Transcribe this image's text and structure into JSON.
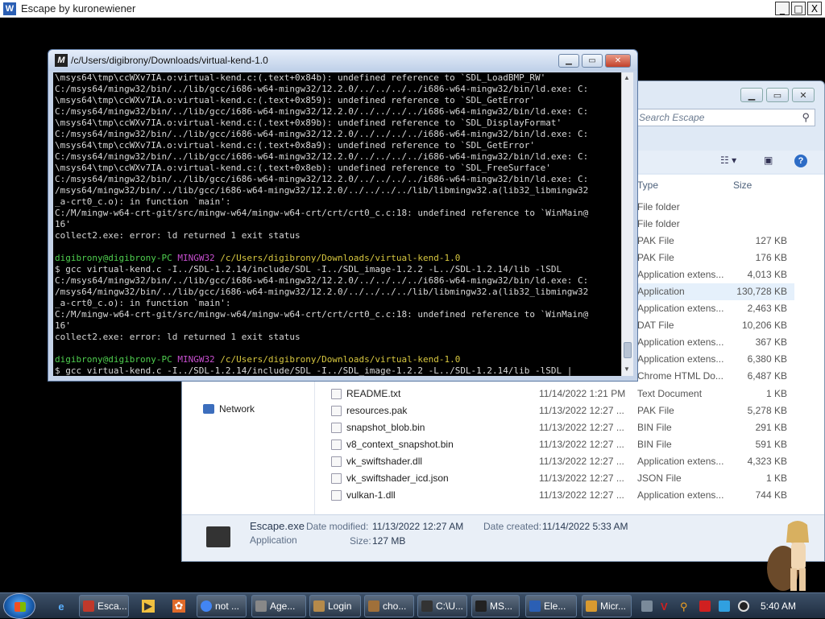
{
  "outer_window": {
    "title": "Escape by kuronewiener",
    "minimize": "_",
    "maximize": "□",
    "close": "X"
  },
  "explorer": {
    "search_placeholder": "Search Escape",
    "columns": {
      "type": "Type",
      "size": "Size"
    },
    "partial_rows": [
      {
        "type": "File folder",
        "size": ""
      },
      {
        "type": "File folder",
        "size": ""
      },
      {
        "type": "PAK File",
        "size": "127 KB"
      },
      {
        "type": "PAK File",
        "size": "176 KB"
      },
      {
        "type": "Application extens...",
        "size": "4,013 KB"
      },
      {
        "type": "Application",
        "size": "130,728 KB"
      },
      {
        "type": "Application extens...",
        "size": "2,463 KB"
      },
      {
        "type": "DAT File",
        "size": "10,206 KB"
      },
      {
        "type": "Application extens...",
        "size": "367 KB"
      },
      {
        "type": "Application extens...",
        "size": "6,380 KB"
      },
      {
        "type": "Chrome HTML Do...",
        "size": "6,487 KB"
      }
    ],
    "rows": [
      {
        "name": "README.txt",
        "date": "11/14/2022 1:21 PM",
        "type": "Text Document",
        "size": "1 KB"
      },
      {
        "name": "resources.pak",
        "date": "11/13/2022 12:27 ...",
        "type": "PAK File",
        "size": "5,278 KB"
      },
      {
        "name": "snapshot_blob.bin",
        "date": "11/13/2022 12:27 ...",
        "type": "BIN File",
        "size": "291 KB"
      },
      {
        "name": "v8_context_snapshot.bin",
        "date": "11/13/2022 12:27 ...",
        "type": "BIN File",
        "size": "591 KB"
      },
      {
        "name": "vk_swiftshader.dll",
        "date": "11/13/2022 12:27 ...",
        "type": "Application extens...",
        "size": "4,323 KB"
      },
      {
        "name": "vk_swiftshader_icd.json",
        "date": "11/13/2022 12:27 ...",
        "type": "JSON File",
        "size": "1 KB"
      },
      {
        "name": "vulkan-1.dll",
        "date": "11/13/2022 12:27 ...",
        "type": "Application extens...",
        "size": "744 KB"
      }
    ],
    "nav_network": "Network",
    "details": {
      "filename": "Escape.exe",
      "filetype": "Application",
      "modified_label": "Date modified:",
      "modified_value": "11/13/2022 12:27 AM",
      "created_label": "Date created:",
      "created_value": "11/14/2022 5:33 AM",
      "size_label": "Size:",
      "size_value": "127 MB"
    }
  },
  "terminal": {
    "title": "/c/Users/digibrony/Downloads/virtual-kend-1.0",
    "lines": [
      {
        "t": "\\msys64\\tmp\\ccWXv7IA.o:virtual-kend.c:(.text+0x84b): undefined reference to `SDL_LoadBMP_RW'",
        "c": ""
      },
      {
        "t": "C:/msys64/mingw32/bin/../lib/gcc/i686-w64-mingw32/12.2.0/../../../../i686-w64-mingw32/bin/ld.exe: C:",
        "c": ""
      },
      {
        "t": "\\msys64\\tmp\\ccWXv7IA.o:virtual-kend.c:(.text+0x859): undefined reference to `SDL_GetError'",
        "c": ""
      },
      {
        "t": "C:/msys64/mingw32/bin/../lib/gcc/i686-w64-mingw32/12.2.0/../../../../i686-w64-mingw32/bin/ld.exe: C:",
        "c": ""
      },
      {
        "t": "\\msys64\\tmp\\ccWXv7IA.o:virtual-kend.c:(.text+0x89b): undefined reference to `SDL_DisplayFormat'",
        "c": ""
      },
      {
        "t": "C:/msys64/mingw32/bin/../lib/gcc/i686-w64-mingw32/12.2.0/../../../../i686-w64-mingw32/bin/ld.exe: C:",
        "c": ""
      },
      {
        "t": "\\msys64\\tmp\\ccWXv7IA.o:virtual-kend.c:(.text+0x8a9): undefined reference to `SDL_GetError'",
        "c": ""
      },
      {
        "t": "C:/msys64/mingw32/bin/../lib/gcc/i686-w64-mingw32/12.2.0/../../../../i686-w64-mingw32/bin/ld.exe: C:",
        "c": ""
      },
      {
        "t": "\\msys64\\tmp\\ccWXv7IA.o:virtual-kend.c:(.text+0x8eb): undefined reference to `SDL_FreeSurface'",
        "c": ""
      },
      {
        "t": "C:/msys64/mingw32/bin/../lib/gcc/i686-w64-mingw32/12.2.0/../../../../i686-w64-mingw32/bin/ld.exe: C:",
        "c": ""
      },
      {
        "t": "/msys64/mingw32/bin/../lib/gcc/i686-w64-mingw32/12.2.0/../../../../lib/libmingw32.a(lib32_libmingw32",
        "c": ""
      },
      {
        "t": "_a-crt0_c.o): in function `main':",
        "c": ""
      },
      {
        "t": "C:/M/mingw-w64-crt-git/src/mingw-w64/mingw-w64-crt/crt/crt0_c.c:18: undefined reference to `WinMain@",
        "c": ""
      },
      {
        "t": "16'",
        "c": ""
      },
      {
        "t": "collect2.exe: error: ld returned 1 exit status",
        "c": ""
      },
      {
        "t": "",
        "c": ""
      },
      {
        "t": "PROMPT",
        "c": "prompt"
      },
      {
        "t": "$ gcc virtual-kend.c -I../SDL-1.2.14/include/SDL -I../SDL_image-1.2.2 -L../SDL-1.2.14/lib -lSDL",
        "c": ""
      },
      {
        "t": "C:/msys64/mingw32/bin/../lib/gcc/i686-w64-mingw32/12.2.0/../../../../i686-w64-mingw32/bin/ld.exe: C:",
        "c": ""
      },
      {
        "t": "/msys64/mingw32/bin/../lib/gcc/i686-w64-mingw32/12.2.0/../../../../lib/libmingw32.a(lib32_libmingw32",
        "c": ""
      },
      {
        "t": "_a-crt0_c.o): in function `main':",
        "c": ""
      },
      {
        "t": "C:/M/mingw-w64-crt-git/src/mingw-w64/mingw-w64-crt/crt/crt0_c.c:18: undefined reference to `WinMain@",
        "c": ""
      },
      {
        "t": "16'",
        "c": ""
      },
      {
        "t": "collect2.exe: error: ld returned 1 exit status",
        "c": ""
      },
      {
        "t": "",
        "c": ""
      },
      {
        "t": "PROMPT",
        "c": "prompt"
      },
      {
        "t": "$ gcc virtual-kend.c -I../SDL-1.2.14/include/SDL -I../SDL_image-1.2.2 -L../SDL-1.2.14/lib -lSDL |",
        "c": ""
      }
    ],
    "prompt": {
      "user": "digibrony@digibrony-PC",
      "env": "MINGW32",
      "path": "/c/Users/digibrony/Downloads/virtual-kend-1.0"
    }
  },
  "taskbar": {
    "buttons": [
      {
        "label": "Esca...",
        "color": "#c0392b"
      },
      {
        "label": "not ...",
        "color": "#4285f4"
      },
      {
        "label": "Age...",
        "color": "#888888"
      },
      {
        "label": "Login",
        "color": "#b58a4a"
      },
      {
        "label": "cho...",
        "color": "#a0703a"
      },
      {
        "label": "C:\\U...",
        "color": "#333333"
      },
      {
        "label": "MS...",
        "color": "#222222"
      },
      {
        "label": "Ele...",
        "color": "#2b5fb4"
      },
      {
        "label": "Micr...",
        "color": "#d89a30"
      }
    ],
    "clock": "5:40 AM"
  }
}
